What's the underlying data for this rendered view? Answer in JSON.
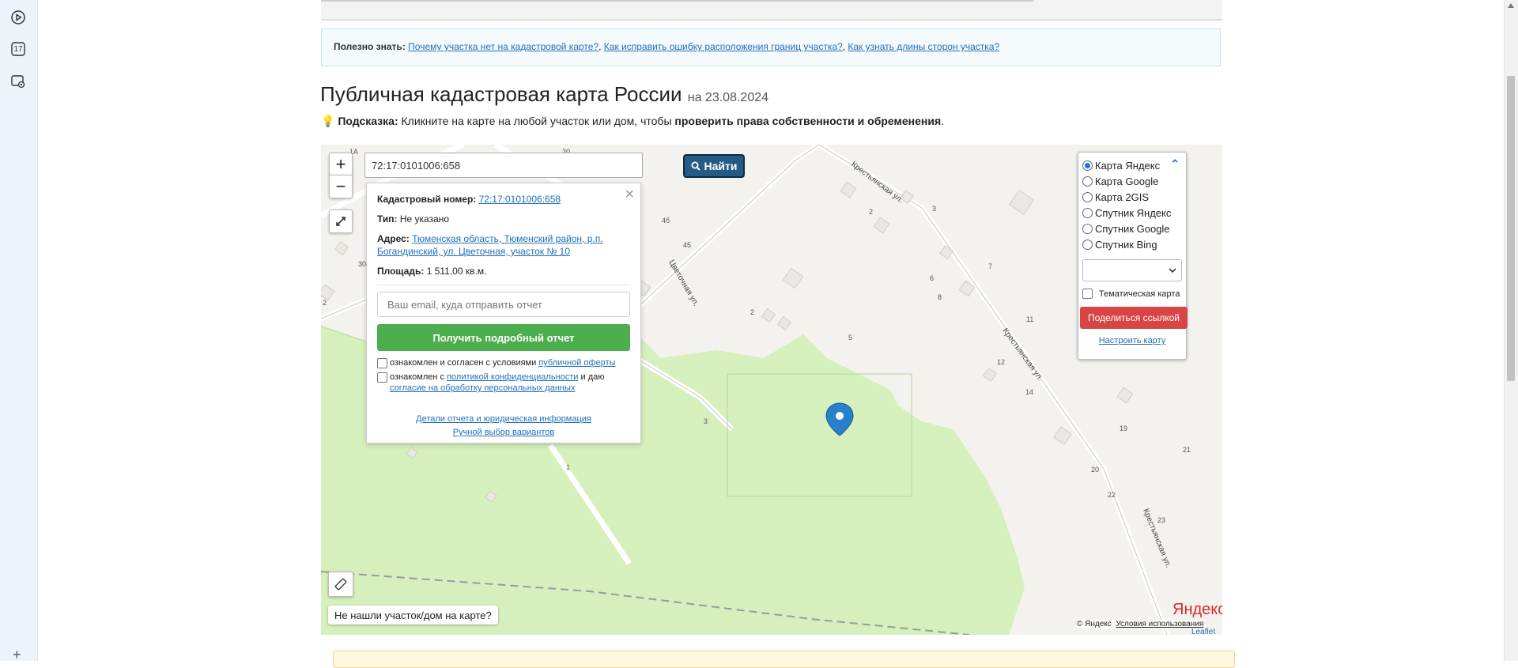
{
  "sidepanel": {
    "items": [
      "play-icon",
      "calendar-icon",
      "screenshot-icon"
    ],
    "calendar_label": "17",
    "add_label": "+"
  },
  "useful": {
    "prefix": "Полезно знать:",
    "links": [
      "Почему участка нет на кадастровой карте?",
      "Как исправить ошибку расположения границ участка?",
      "Как узнать длины сторон участка?"
    ]
  },
  "title": {
    "main": "Публичная кадастровая карта России",
    "date": "на 23.08.2024"
  },
  "hint": {
    "label": "Подсказка:",
    "text": "Кликните на карте на любой участок или дом, чтобы",
    "bold": "проверить права собственности и обременения",
    "end": "."
  },
  "map": {
    "zoom_in": "+",
    "zoom_out": "−",
    "search_value": "72:17:0101006:658",
    "search_button": "Найти",
    "street_labels": [
      "Крестьянская ул.",
      "Крестьянская ул.",
      "Крестьянская ул.",
      "Цветочная ул."
    ],
    "house_numbers": [
      "2",
      "3",
      "4б",
      "45",
      "7",
      "6",
      "8",
      "2",
      "5",
      "11",
      "12",
      "14",
      "19",
      "21",
      "20",
      "22",
      "23",
      "3",
      "1",
      "30",
      "2",
      "1A",
      "20"
    ],
    "not_found": "Не нашли участок/дом на карте?",
    "yandex_logo": "Яндекс",
    "attribution": "© Яндекс",
    "terms": "Условия использования",
    "leaflet": "Leaflet"
  },
  "popup": {
    "cad_label": "Кадастровый номер:",
    "cad_value": "72:17:0101006:658",
    "type_label": "Тип:",
    "type_value": "Не указано",
    "address_label": "Адрес:",
    "address_value": "Тюменская область, Тюменский район, р.п. Богандинский, ул. Цветочная, участок № 10",
    "area_label": "Площадь:",
    "area_value": "1 511.00 кв.м.",
    "email_placeholder": "Ваш email, куда отправить отчет",
    "report_button": "Получить подробный отчет",
    "consent1_text": "ознакомлен и согласен с условиями",
    "consent1_link": "публичной оферты",
    "consent2_text": "ознакомлен с",
    "consent2_link1": "политикой конфиденциальности",
    "consent2_mid": "и даю",
    "consent2_link2": "согласие на обработку персональных данных",
    "details_link": "Детали отчета и юридическая информация",
    "manual_link": "Ручной выбор вариантов",
    "close": "×"
  },
  "layers": {
    "options": [
      "Карта Яндекс",
      "Карта Google",
      "Карта 2GIS",
      "Спутник Яндекс",
      "Спутник Google",
      "Спутник Bing"
    ],
    "selected": "Карта Яндекс",
    "thematic": "Тематическая карта",
    "share": "Поделиться ссылкой",
    "setup": "Настроить карту"
  },
  "colors": {
    "accent": "#235a86",
    "green_button": "#4cae4c",
    "red_button": "#d94545",
    "map_green": "#d5f0bc"
  }
}
